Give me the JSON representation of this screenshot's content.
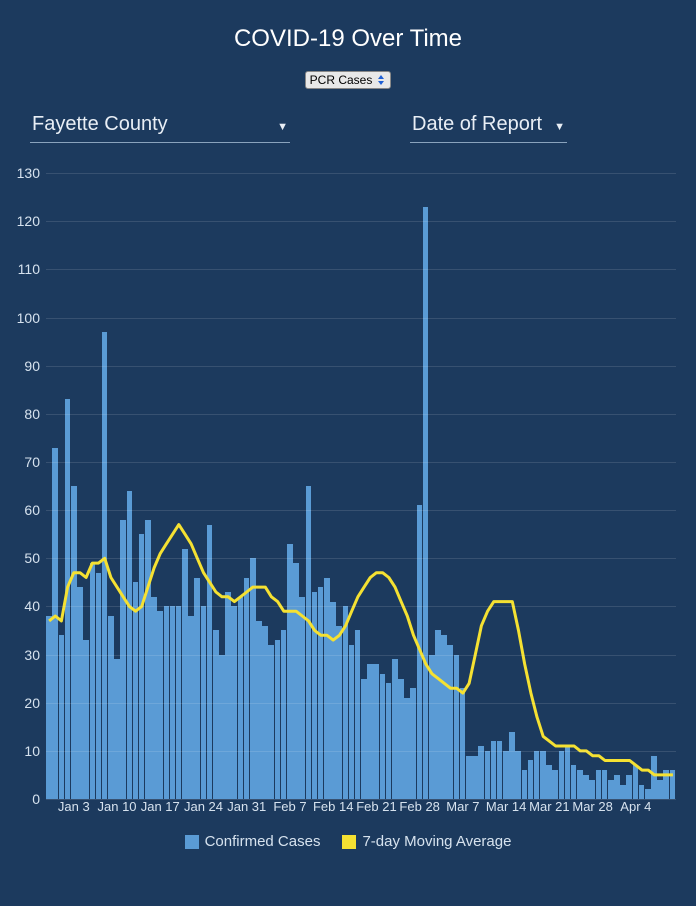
{
  "title": "COVID-19 Over Time",
  "metric_select": {
    "label": "PCR Cases"
  },
  "county_dropdown": {
    "label": "Fayette County"
  },
  "date_dropdown": {
    "label": "Date of Report"
  },
  "legend": {
    "confirmed": "Confirmed Cases",
    "moving_avg": "7-day Moving Average"
  },
  "chart_data": {
    "type": "bar",
    "title": "COVID-19 Over Time",
    "xlabel": "",
    "ylabel": "",
    "ylim": [
      0,
      135
    ],
    "yticks": [
      0,
      10,
      20,
      30,
      40,
      50,
      60,
      70,
      80,
      90,
      100,
      110,
      120,
      130
    ],
    "xticks": [
      "Jan 3",
      "Jan 10",
      "Jan 17",
      "Jan 24",
      "Jan 31",
      "Feb 7",
      "Feb 14",
      "Feb 21",
      "Feb 28",
      "Mar 7",
      "Mar 14",
      "Mar 21",
      "Mar 28",
      "Apr 4"
    ],
    "categories_start": "2020-12-30",
    "series": [
      {
        "name": "Confirmed Cases",
        "color": "#5a9bd5",
        "values": [
          38,
          73,
          34,
          83,
          65,
          44,
          33,
          49,
          47,
          97,
          38,
          29,
          58,
          64,
          45,
          55,
          58,
          42,
          39,
          40,
          40,
          40,
          52,
          38,
          46,
          40,
          57,
          35,
          30,
          43,
          40,
          42,
          46,
          50,
          37,
          36,
          32,
          33,
          35,
          53,
          49,
          42,
          65,
          43,
          44,
          46,
          41,
          36,
          40,
          32,
          35,
          25,
          28,
          28,
          26,
          24,
          29,
          25,
          21,
          23,
          61,
          123,
          30,
          35,
          34,
          32,
          30,
          23,
          9,
          9,
          11,
          10,
          12,
          12,
          10,
          14,
          10,
          6,
          8,
          10,
          10,
          7,
          6,
          10,
          11,
          7,
          6,
          5,
          4,
          6,
          6,
          4,
          5,
          3,
          5,
          7,
          3,
          2,
          9,
          4,
          6,
          6
        ]
      },
      {
        "name": "7-day Moving Average",
        "color": "#f5e132",
        "values": [
          37,
          38,
          37,
          44,
          47,
          47,
          46,
          49,
          49,
          50,
          46,
          44,
          42,
          40,
          39,
          40,
          44,
          48,
          51,
          53,
          55,
          57,
          55,
          53,
          50,
          47,
          45,
          43,
          42,
          42,
          41,
          42,
          43,
          44,
          44,
          44,
          42,
          41,
          39,
          39,
          39,
          38,
          37,
          35,
          34,
          34,
          33,
          34,
          36,
          39,
          42,
          44,
          46,
          47,
          47,
          46,
          44,
          41,
          38,
          34,
          31,
          28,
          26,
          25,
          24,
          23,
          23,
          22,
          24,
          30,
          36,
          39,
          41,
          41,
          41,
          41,
          35,
          28,
          22,
          17,
          13,
          12,
          11,
          11,
          11,
          11,
          10,
          10,
          9,
          9,
          8,
          8,
          8,
          8,
          8,
          7,
          6,
          6,
          5,
          5,
          5,
          5
        ]
      }
    ]
  }
}
